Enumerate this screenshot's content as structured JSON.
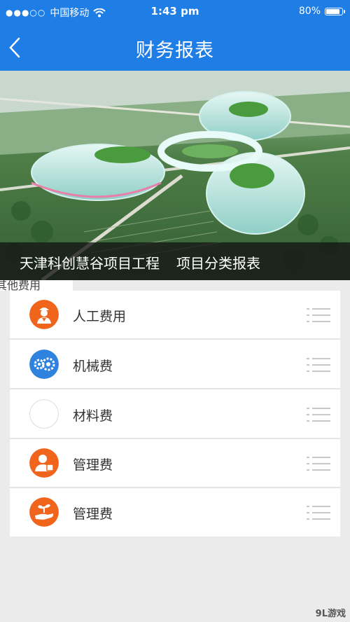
{
  "status_bar": {
    "carrier": "中国移动",
    "time": "1:43 pm",
    "battery": "80%",
    "battery_level": 0.8
  },
  "nav": {
    "title": "财务报表"
  },
  "banner": {
    "project_name": "天津科创慧谷项目工程",
    "subtitle": "项目分类报表"
  },
  "section_tag": "其他费用",
  "items": [
    {
      "label": "人工费用",
      "icon": "worker-icon",
      "icon_color": "#f0641c"
    },
    {
      "label": "机械费",
      "icon": "gears-icon",
      "icon_color": "#2f82de"
    },
    {
      "label": "材料费",
      "icon": "empty-circle-icon",
      "icon_color": "#ffffff"
    },
    {
      "label": "管理费",
      "icon": "manager-icon",
      "icon_color": "#f0641c"
    },
    {
      "label": "管理费",
      "icon": "hand-plant-icon",
      "icon_color": "#f0641c"
    }
  ],
  "watermark": "9L游戏"
}
